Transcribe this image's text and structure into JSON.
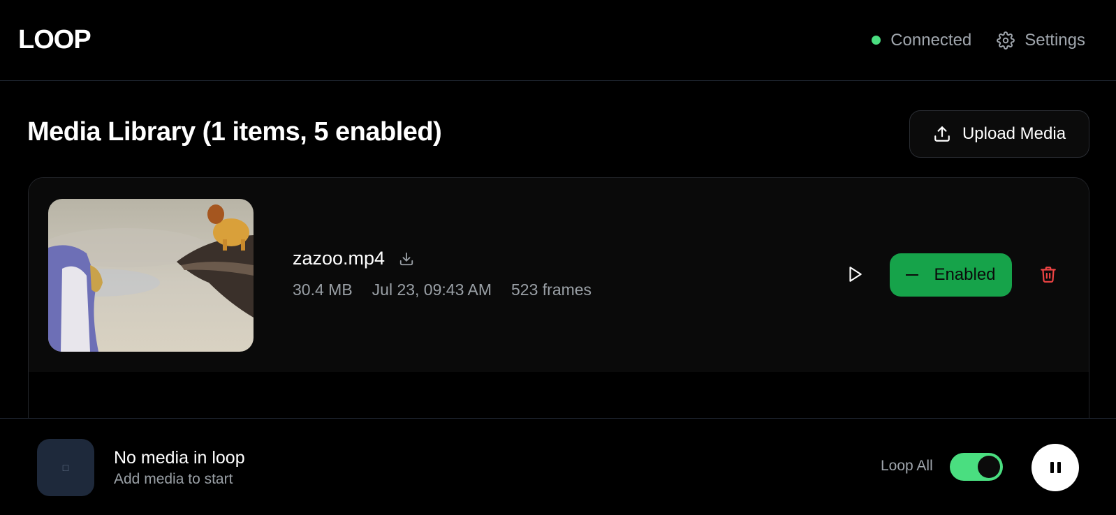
{
  "header": {
    "logo": "LOOP",
    "status_text": "Connected",
    "status_color": "#4ade80",
    "settings_label": "Settings",
    "settings_icon": "gear-icon"
  },
  "library": {
    "title": "Media Library (1 items, 5 enabled)",
    "upload_label": "Upload Media",
    "upload_icon": "upload-icon",
    "items": [
      {
        "name": "zazoo.mp4",
        "size": "30.4 MB",
        "date": "Jul 23, 09:43 AM",
        "frames": "523 frames",
        "status_label": "Enabled",
        "status_color": "#16a34a"
      }
    ]
  },
  "player": {
    "placeholder_glyph": "□",
    "title": "No media in loop",
    "subtitle": "Add media to start",
    "loop_label": "Loop All",
    "loop_on": true
  }
}
